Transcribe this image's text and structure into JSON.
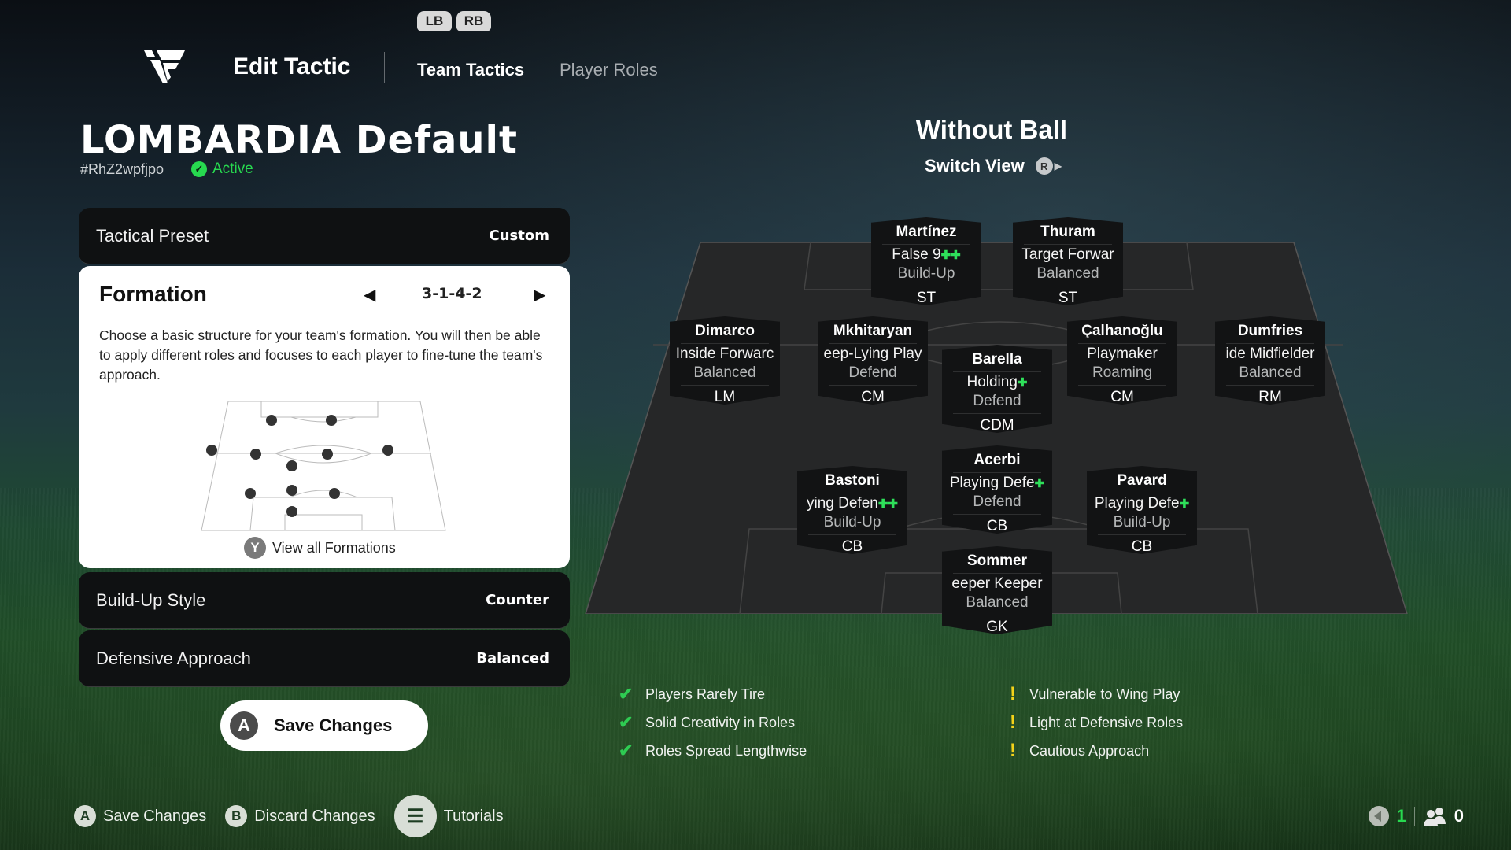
{
  "header": {
    "bumpers": [
      "LB",
      "RB"
    ],
    "app_title": "Edit Tactic",
    "tabs": [
      {
        "label": "Team Tactics",
        "active": true
      },
      {
        "label": "Player Roles",
        "active": false
      }
    ]
  },
  "tactic": {
    "name": "LOMBARDIA Default",
    "code": "#RhZ2wpfjpo",
    "status": "Active"
  },
  "settings": {
    "tactical_preset": {
      "label": "Tactical Preset",
      "value": "Custom"
    },
    "formation": {
      "label": "Formation",
      "value": "3-1-4-2",
      "description": "Choose a basic structure for your team's formation. You will then be able to apply different roles and focuses to each player to fine-tune the team's approach.",
      "view_all_button": "Y",
      "view_all_label": "View all Formations"
    },
    "build_up_style": {
      "label": "Build-Up Style",
      "value": "Counter"
    },
    "defensive_approach": {
      "label": "Defensive Approach",
      "value": "Balanced"
    }
  },
  "save_button": {
    "button": "A",
    "label": "Save Changes"
  },
  "footer": {
    "hints": [
      {
        "button": "A",
        "label": "Save Changes"
      },
      {
        "button": "B",
        "label": "Discard Changes"
      },
      {
        "button": "menu-icon",
        "label": "Tutorials"
      }
    ],
    "status": {
      "voice_count": "1",
      "party_count": "0"
    }
  },
  "view": {
    "title": "Without Ball",
    "switch_label": "Switch View",
    "switch_button": "R"
  },
  "players": [
    {
      "name": "Martínez",
      "role": "False 9",
      "plus": "✚✚",
      "focus": "Build-Up",
      "position": "ST"
    },
    {
      "name": "Thuram",
      "role": "Target Forward",
      "plus": "",
      "focus": "Balanced",
      "position": "ST"
    },
    {
      "name": "Dimarco",
      "role": "Inside Forward",
      "plus": "",
      "focus": "Balanced",
      "position": "LM"
    },
    {
      "name": "Mkhitaryan",
      "role": "Deep-Lying Playmaker",
      "plus": "",
      "focus": "Defend",
      "position": "CM"
    },
    {
      "name": "Barella",
      "role": "Holding",
      "plus": "✚",
      "focus": "Defend",
      "position": "CDM"
    },
    {
      "name": "Çalhanoğlu",
      "role": "Playmaker",
      "plus": "",
      "focus": "Roaming",
      "position": "CM"
    },
    {
      "name": "Dumfries",
      "role": "Wide Midfielder",
      "plus": "",
      "focus": "Balanced",
      "position": "RM"
    },
    {
      "name": "Bastoni",
      "role": "Ball-Playing Defender",
      "plus": "✚✚",
      "focus": "Build-Up",
      "position": "CB"
    },
    {
      "name": "Acerbi",
      "role": "Ball-Playing Defender",
      "plus": "✚",
      "focus": "Defend",
      "position": "CB"
    },
    {
      "name": "Pavard",
      "role": "Ball-Playing Defender",
      "plus": "✚",
      "focus": "Build-Up",
      "position": "CB"
    },
    {
      "name": "Sommer",
      "role": "Goalkeeper Keeper",
      "plus": "",
      "focus": "Balanced",
      "position": "GK"
    }
  ],
  "player_role_display": [
    "False 9",
    "Target Forwar",
    "Inside Forwarc",
    "eep-Lying Play",
    "Holding",
    "Playmaker",
    "ide Midfielder",
    "ying Defen",
    "Playing Defe",
    "Playing Defe",
    "eeper Keeper"
  ],
  "strengths": [
    "Players Rarely Tire",
    "Solid Creativity in Roles",
    "Roles Spread Lengthwise"
  ],
  "weaknesses": [
    "Vulnerable to Wing Play",
    "Light at Defensive Roles",
    "Cautious Approach"
  ],
  "colors": {
    "accent_green": "#27d94f",
    "warning_yellow": "#f3d21a",
    "card_dark": "#121314"
  }
}
